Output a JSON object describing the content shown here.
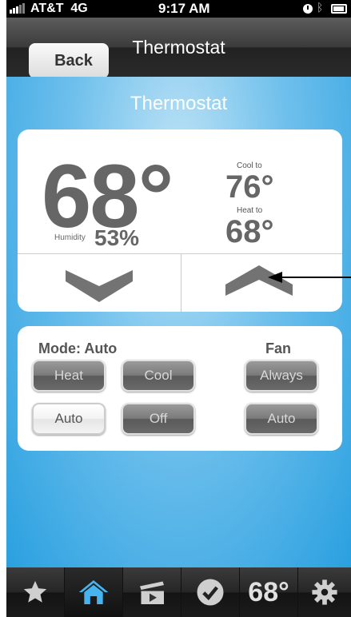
{
  "status_bar": {
    "carrier": "AT&T",
    "network": "4G",
    "time": "9:17 AM"
  },
  "nav": {
    "back_label": "Back",
    "title": "Thermostat"
  },
  "main": {
    "title": "Thermostat",
    "current_temp": "68°",
    "humidity_label": "Humidity",
    "humidity_value": "53%",
    "cool_label": "Cool to",
    "cool_value": "76°",
    "heat_label": "Heat to",
    "heat_value": "68°"
  },
  "mode": {
    "label": "Mode:  Auto",
    "buttons": [
      "Heat",
      "Cool",
      "Auto",
      "Off"
    ],
    "selected": "Auto"
  },
  "fan": {
    "label": "Fan",
    "buttons": [
      "Always",
      "Auto"
    ]
  },
  "tab_bar": {
    "items": [
      "favorites",
      "home",
      "media",
      "tasks",
      "thermostat",
      "settings"
    ],
    "selected": "home",
    "temp_label": "68°"
  },
  "colors": {
    "accent_blue": "#2aa0e0",
    "gauge_grey": "#666666",
    "home_icon_blue": "#45b4f0"
  },
  "icons": [
    "signal-icon",
    "clock-icon",
    "bluetooth-icon",
    "battery-icon",
    "chevron-down-icon",
    "chevron-up-icon",
    "star-icon",
    "home-icon",
    "clapperboard-icon",
    "checkmark-icon",
    "gear-icon"
  ]
}
